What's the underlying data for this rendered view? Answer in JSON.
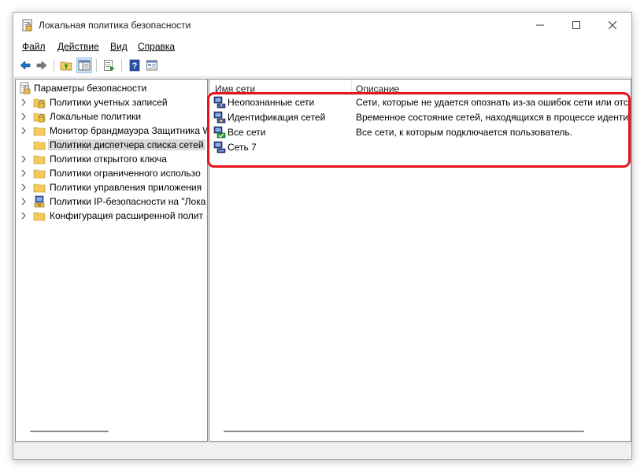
{
  "window": {
    "title": "Локальная политика безопасности",
    "minimize_symbol": "—",
    "maximize_symbol": "☐",
    "close_symbol": "✕"
  },
  "menu": {
    "items": [
      "Файл",
      "Действие",
      "Вид",
      "Справка"
    ],
    "underline_first": true
  },
  "toolbar": {
    "icons": [
      "back-arrow-icon",
      "forward-arrow-icon",
      "up-folder-icon",
      "show-tree-icon",
      "export-list-icon",
      "help-icon",
      "properties-icon"
    ],
    "pressed": "show-tree-icon"
  },
  "tree": {
    "root": "Параметры безопасности",
    "items": [
      {
        "label": "Политики учетных записей",
        "icon": "folder-lock-icon"
      },
      {
        "label": "Локальные политики",
        "icon": "folder-lock-icon"
      },
      {
        "label": "Монитор брандмауэра Защитника W",
        "icon": "folder-icon"
      },
      {
        "label": "Политики диспетчера списка сетей",
        "icon": "folder-icon",
        "selected": true
      },
      {
        "label": "Политики открытого ключа",
        "icon": "folder-icon"
      },
      {
        "label": "Политики ограниченного использо",
        "icon": "folder-icon"
      },
      {
        "label": "Политики управления приложения",
        "icon": "folder-icon"
      },
      {
        "label": "Политики IP-безопасности на \"Лока",
        "icon": "ipsec-policy-icon"
      },
      {
        "label": "Конфигурация расширенной полит",
        "icon": "folder-icon"
      }
    ]
  },
  "list": {
    "columns": [
      "Имя сети",
      "Описание"
    ],
    "rows": [
      {
        "name": "Неопознанные сети",
        "desc": "Сети, которые не удается опознать из-за ошибок сети или отсу",
        "icon": "unidentified-network-icon"
      },
      {
        "name": "Идентификация сетей",
        "desc": "Временное состояние сетей, находящихся в процессе идентиф",
        "icon": "identifying-network-icon"
      },
      {
        "name": "Все сети",
        "desc": "Все сети, к которым подключается пользователь.",
        "icon": "all-networks-icon"
      },
      {
        "name": "Сеть 7",
        "desc": "",
        "icon": "network-icon"
      }
    ]
  },
  "colors": {
    "highlight": "#e8141c",
    "selection": "#d9d9d9",
    "folder": "#f5c95a",
    "toolbar_arrow": "#1e73c8"
  }
}
